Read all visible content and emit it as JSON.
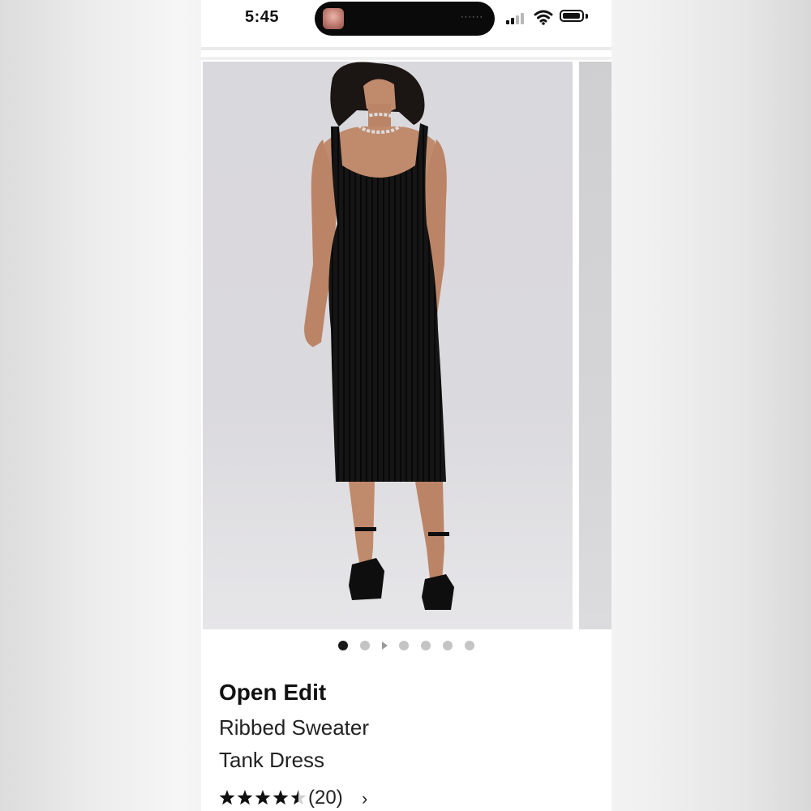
{
  "status_bar": {
    "time": "5:45",
    "island_indicator": "······"
  },
  "icons": {
    "signal": "cellular-signal-icon",
    "wifi": "wifi-icon",
    "battery": "battery-icon"
  },
  "gallery": {
    "image_count": 6,
    "active_index": 0,
    "has_video_indicator": true
  },
  "product": {
    "brand": "Open Edit",
    "name_line1": "Ribbed Sweater",
    "name_line2": "Tank Dress",
    "rating": 4.5,
    "rating_max": 5,
    "review_count": "(20)",
    "chevron": "›"
  },
  "colors": {
    "text": "#111111",
    "dot_active": "#1a1a1a",
    "dot_inactive": "#c4c4c4",
    "dress": "#141414"
  }
}
